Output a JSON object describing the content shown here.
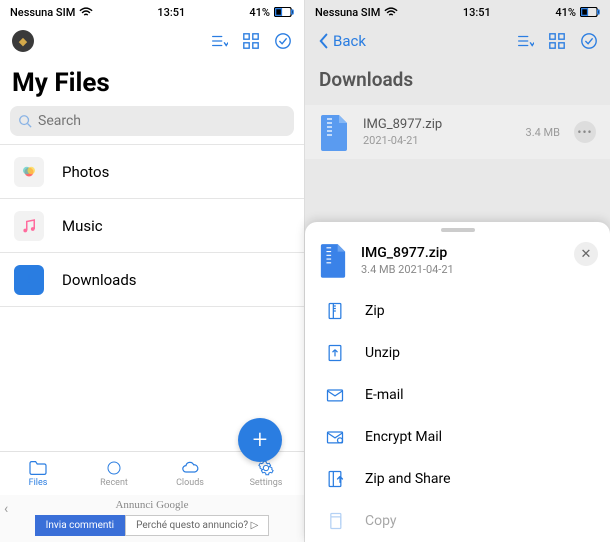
{
  "status": {
    "carrier": "Nessuna SIM",
    "time": "13:51",
    "battery": "41%"
  },
  "left": {
    "title": "My Files",
    "search_placeholder": "Search",
    "rows": [
      {
        "label": "Photos"
      },
      {
        "label": "Music"
      },
      {
        "label": "Downloads"
      }
    ],
    "tabs": [
      {
        "label": "Files"
      },
      {
        "label": "Recent"
      },
      {
        "label": "Clouds"
      },
      {
        "label": "Settings"
      }
    ],
    "ad": {
      "title": "Annunci Google",
      "btn1": "Invia commenti",
      "btn2": "Perché questo annuncio? ▷"
    }
  },
  "right": {
    "back": "Back",
    "title": "Downloads",
    "file": {
      "name": "IMG_8977.zip",
      "date": "2021-04-21",
      "size": "3.4 MB"
    },
    "sheet": {
      "name": "IMG_8977.zip",
      "meta": "3.4 MB 2021-04-21",
      "items": [
        {
          "label": "Zip"
        },
        {
          "label": "Unzip"
        },
        {
          "label": "E-mail"
        },
        {
          "label": "Encrypt Mail"
        },
        {
          "label": "Zip and Share"
        },
        {
          "label": "Copy"
        }
      ]
    }
  }
}
